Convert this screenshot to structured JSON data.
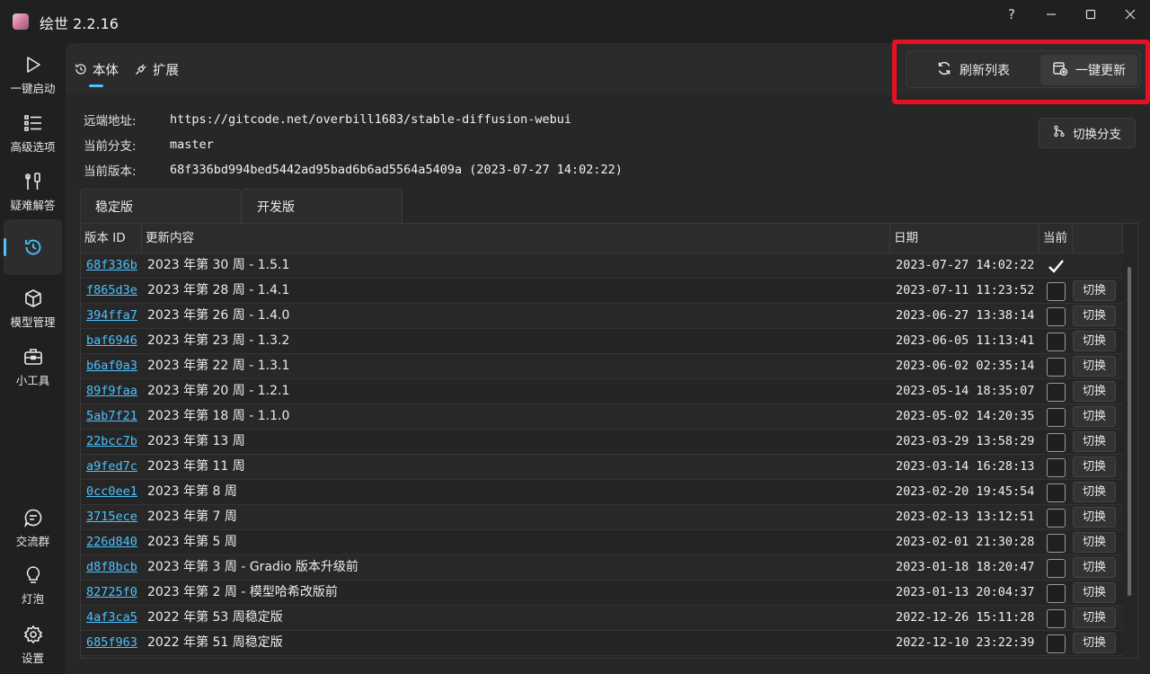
{
  "window": {
    "title": "绘世 2.2.16",
    "help": "?",
    "minimize": "—",
    "maximize": "☐",
    "close": "✕"
  },
  "sidebar": {
    "items": [
      {
        "label": "一键启动"
      },
      {
        "label": "高级选项"
      },
      {
        "label": "疑难解答"
      },
      {
        "label": ""
      },
      {
        "label": "模型管理"
      },
      {
        "label": "小工具"
      },
      {
        "label": "交流群"
      },
      {
        "label": "灯泡"
      },
      {
        "label": "设置"
      }
    ]
  },
  "topbar": {
    "tabs": [
      {
        "label": "本体"
      },
      {
        "label": "扩展"
      }
    ],
    "refresh_label": "刷新列表",
    "update_label": "一键更新"
  },
  "info": {
    "remote_key": "远端地址:",
    "remote_value": "https://gitcode.net/overbill1683/stable-diffusion-webui",
    "branch_key": "当前分支:",
    "branch_value": "master",
    "version_key": "当前版本:",
    "version_value": "68f336bd994bed5442ad95bad6b6ad5564a5409a (2023-07-27 14:02:22)",
    "switch_branch_label": "切换分支"
  },
  "version_tabs": [
    {
      "label": "稳定版"
    },
    {
      "label": "开发版"
    }
  ],
  "table": {
    "headers": {
      "id": "版本 ID",
      "msg": "更新内容",
      "date": "日期",
      "current": "当前"
    },
    "switch_label": "切换",
    "rows": [
      {
        "id": "68f336b",
        "msg": "2023 年第 30 周 - 1.5.1",
        "date": "2023-07-27 14:02:22",
        "current": true
      },
      {
        "id": "f865d3e",
        "msg": "2023 年第 28 周 - 1.4.1",
        "date": "2023-07-11 11:23:52",
        "current": false
      },
      {
        "id": "394ffa7",
        "msg": "2023 年第 26 周 - 1.4.0",
        "date": "2023-06-27 13:38:14",
        "current": false
      },
      {
        "id": "baf6946",
        "msg": "2023 年第 23 周 - 1.3.2",
        "date": "2023-06-05 11:13:41",
        "current": false
      },
      {
        "id": "b6af0a3",
        "msg": "2023 年第 22 周 - 1.3.1",
        "date": "2023-06-02 02:35:14",
        "current": false
      },
      {
        "id": "89f9faa",
        "msg": "2023 年第 20 周 - 1.2.1",
        "date": "2023-05-14 18:35:07",
        "current": false
      },
      {
        "id": "5ab7f21",
        "msg": "2023 年第 18 周 - 1.1.0",
        "date": "2023-05-02 14:20:35",
        "current": false
      },
      {
        "id": "22bcc7b",
        "msg": "2023 年第 13 周",
        "date": "2023-03-29 13:58:29",
        "current": false
      },
      {
        "id": "a9fed7c",
        "msg": "2023 年第 11 周",
        "date": "2023-03-14 16:28:13",
        "current": false
      },
      {
        "id": "0cc0ee1",
        "msg": "2023 年第 8 周",
        "date": "2023-02-20 19:45:54",
        "current": false
      },
      {
        "id": "3715ece",
        "msg": "2023 年第 7 周",
        "date": "2023-02-13 13:12:51",
        "current": false
      },
      {
        "id": "226d840",
        "msg": "2023 年第 5 周",
        "date": "2023-02-01 21:30:28",
        "current": false
      },
      {
        "id": "d8f8bcb",
        "msg": "2023 年第 3 周 - Gradio 版本升级前",
        "date": "2023-01-18 18:20:47",
        "current": false
      },
      {
        "id": "82725f0",
        "msg": "2023 年第 2 周 - 模型哈希改版前",
        "date": "2023-01-13 20:04:37",
        "current": false
      },
      {
        "id": "4af3ca5",
        "msg": "2022 年第 53 周稳定版",
        "date": "2022-12-26 15:11:28",
        "current": false
      },
      {
        "id": "685f963",
        "msg": "2022 年第 51 周稳定版",
        "date": "2022-12-10 23:22:39",
        "current": false
      }
    ]
  },
  "colors": {
    "accent": "#4cc2ff",
    "highlight": "#e81123",
    "background": "#202020"
  }
}
